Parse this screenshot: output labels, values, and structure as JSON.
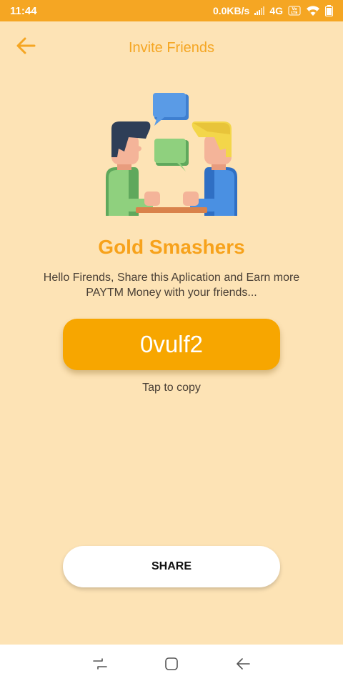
{
  "status_bar": {
    "time": "11:44",
    "network_speed": "0.0KB/s",
    "network_type": "4G",
    "volte_label": "VoLTE",
    "icons": [
      "signal-icon",
      "wifi-icon",
      "battery-icon"
    ]
  },
  "app_bar": {
    "title": "Invite Friends",
    "back_icon": "arrow-left-icon"
  },
  "main": {
    "illustration": "friends-chatting-illustration",
    "app_name": "Gold Smashers",
    "message": "Hello Firends, Share this Aplication and Earn more PAYTM Money with your friends...",
    "referral_code": "0vulf2",
    "tap_hint": "Tap to copy",
    "share_label": "SHARE"
  },
  "navigation_bar": {
    "items": [
      "recents-icon",
      "home-icon",
      "back-icon"
    ]
  },
  "colors": {
    "accent": "#F5A623",
    "background": "#FDE3B5",
    "code_button": "#F7A600",
    "share_button": "#FFFFFF"
  }
}
